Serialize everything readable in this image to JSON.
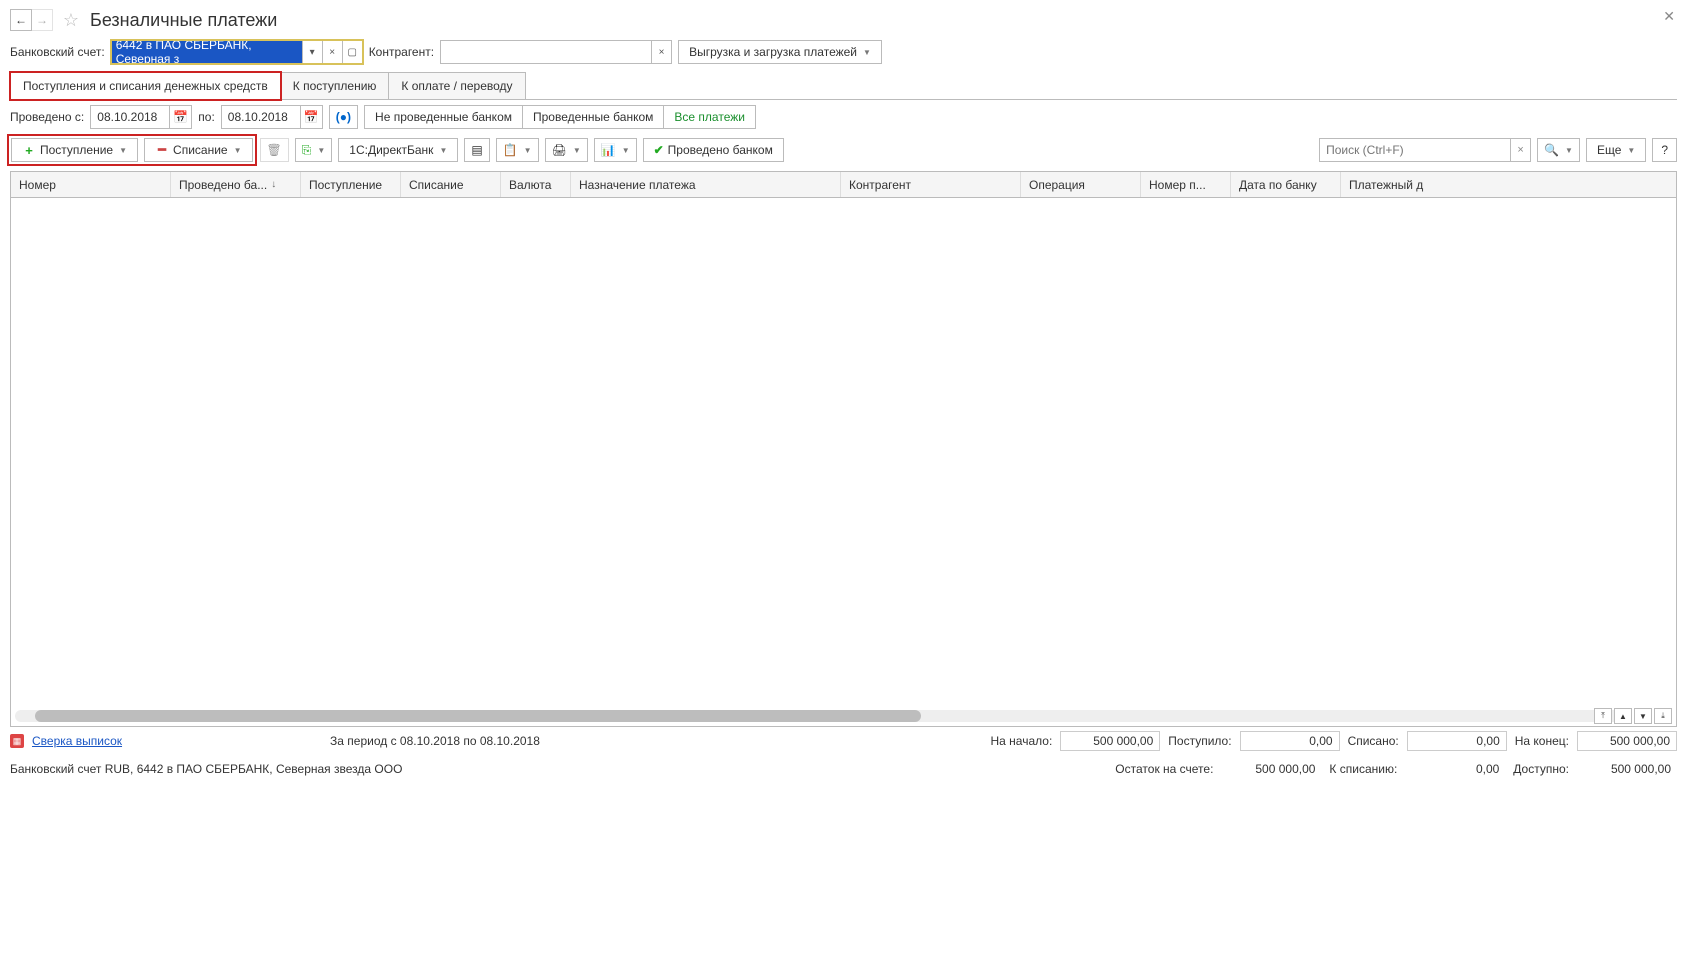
{
  "header": {
    "title": "Безналичные платежи"
  },
  "filters": {
    "account_label": "Банковский счет:",
    "account_value": "6442 в ПАО СБЕРБАНК, Северная з",
    "counterparty_label": "Контрагент:",
    "counterparty_value": "",
    "export_btn": "Выгрузка и загрузка платежей"
  },
  "tabs": [
    "Поступления и списания денежных средств",
    "К поступлению",
    "К оплате / переводу"
  ],
  "datebar": {
    "from_label": "Проведено с:",
    "to_label": "по:",
    "from": "08.10.2018",
    "to": "08.10.2018",
    "seg": [
      "Не проведенные банком",
      "Проведенные банком",
      "Все платежи"
    ]
  },
  "toolbar": {
    "income": "Поступление",
    "outcome": "Списание",
    "directbank": "1С:ДиректБанк",
    "proved": "Проведено банком",
    "search_ph": "Поиск (Ctrl+F)",
    "more": "Еще"
  },
  "columns": [
    "Номер",
    "Проведено ба...",
    "Поступление",
    "Списание",
    "Валюта",
    "Назначение платежа",
    "Контрагент",
    "Операция",
    "Номер п...",
    "Дата по банку",
    "Платежный д"
  ],
  "footer1": {
    "link": "Сверка выписок",
    "period": "За период с 08.10.2018 по 08.10.2018",
    "start_lbl": "На начало:",
    "start_val": "500 000,00",
    "in_lbl": "Поступило:",
    "in_val": "0,00",
    "out_lbl": "Списано:",
    "out_val": "0,00",
    "end_lbl": "На конец:",
    "end_val": "500 000,00"
  },
  "footer2": {
    "info": "Банковский счет RUB, 6442 в ПАО СБЕРБАНК, Северная звезда ООО",
    "bal_lbl": "Остаток на счете:",
    "bal_val": "500 000,00",
    "towrite_lbl": "К списанию:",
    "towrite_val": "0,00",
    "avail_lbl": "Доступно:",
    "avail_val": "500 000,00"
  }
}
